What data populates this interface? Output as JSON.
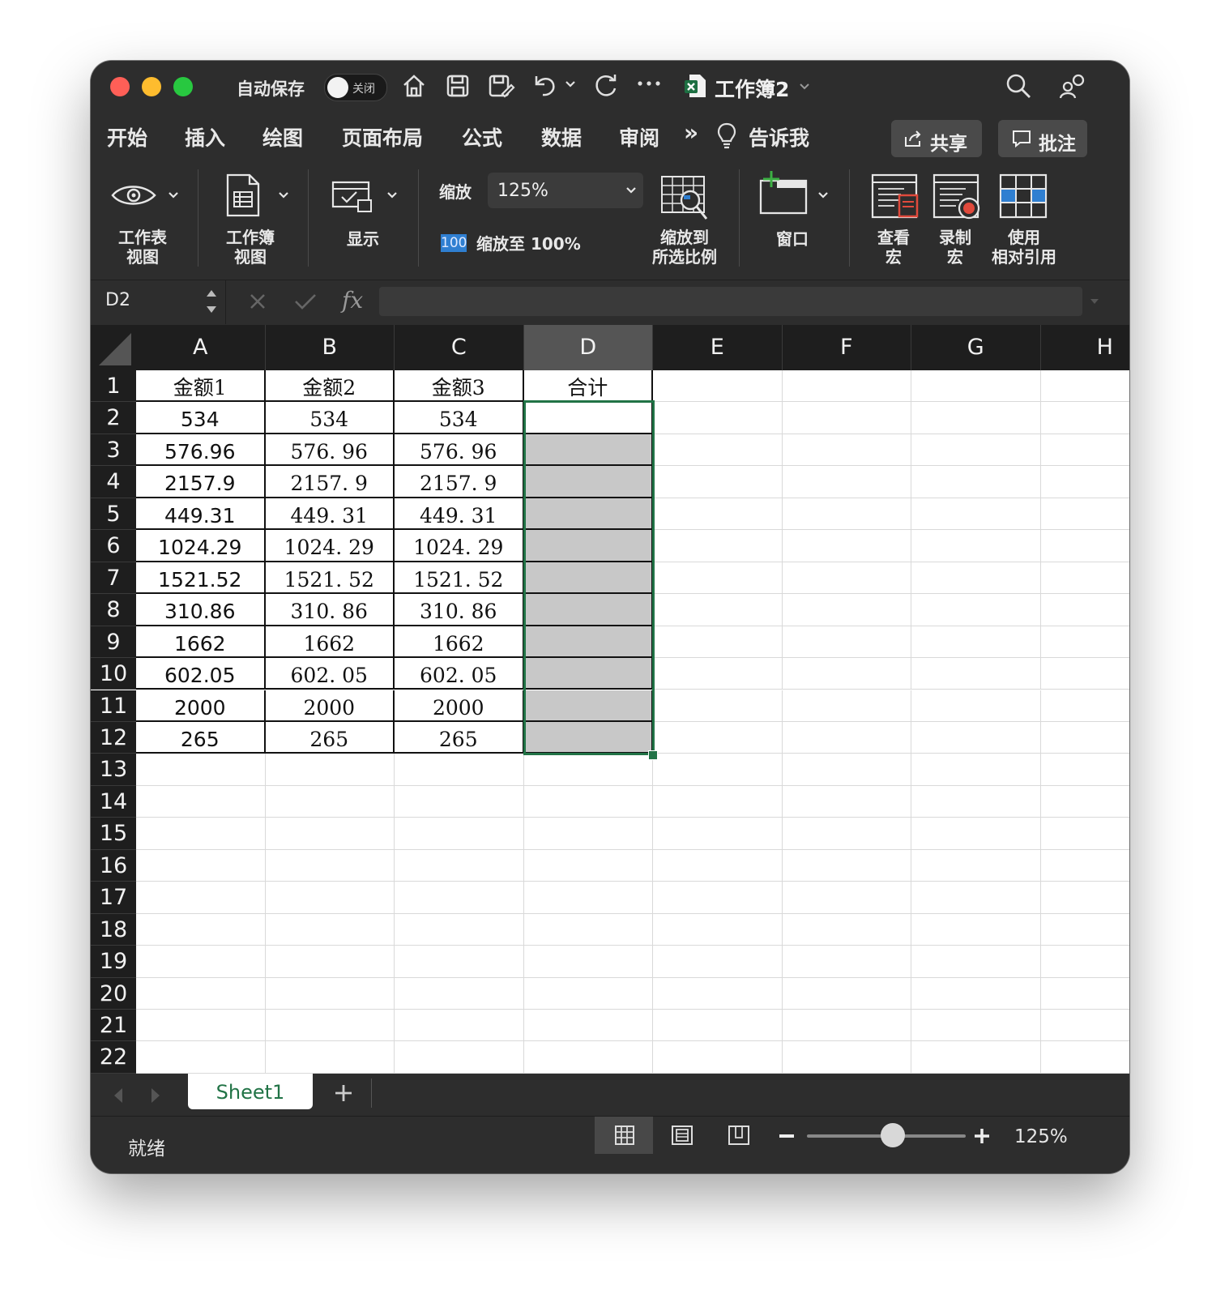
{
  "titlebar": {
    "autosave_label": "自动保存",
    "autosave_state": "关闭",
    "doc_title": "工作簿2"
  },
  "ribbon_tabs": [
    "开始",
    "插入",
    "绘图",
    "页面布局",
    "公式",
    "数据",
    "审阅"
  ],
  "more_tabs": "»",
  "tell_me": "告诉我",
  "share_label": "共享",
  "comments_label": "批注",
  "ribbon": {
    "sheet_view_1": "工作表",
    "sheet_view_2": "视图",
    "workbook_view_1": "工作簿",
    "workbook_view_2": "视图",
    "show": "显示",
    "zoom_label": "缩放",
    "zoom_value": "125%",
    "zoom100_badge": "100",
    "zoom100_label": "缩放至 100%",
    "zoom_sel_1": "缩放到",
    "zoom_sel_2": "所选比例",
    "window": "窗口",
    "view_macros_1": "查看",
    "view_macros_2": "宏",
    "record_macro_1": "录制",
    "record_macro_2": "宏",
    "relative_1": "使用",
    "relative_2": "相对引用"
  },
  "formula_bar": {
    "name_box": "D2",
    "fx": "fx",
    "value": ""
  },
  "columns": [
    "A",
    "B",
    "C",
    "D",
    "E",
    "F",
    "G",
    "H"
  ],
  "rows": [
    "1",
    "2",
    "3",
    "4",
    "5",
    "6",
    "7",
    "8",
    "9",
    "10",
    "11",
    "12",
    "13",
    "14",
    "15",
    "16",
    "17",
    "18",
    "19",
    "20",
    "21",
    "22"
  ],
  "headers": [
    "金额1",
    "金额2",
    "金额3",
    "合计"
  ],
  "col_a": [
    "534",
    "576.96",
    "2157.9",
    "449.31",
    "1024.29",
    "1521.52",
    "310.86",
    "1662",
    "602.05",
    "2000",
    "265"
  ],
  "col_b": [
    "534",
    "576. 96",
    "2157. 9",
    "449. 31",
    "1024. 29",
    "1521. 52",
    "310. 86",
    "1662",
    "602. 05",
    "2000",
    "265"
  ],
  "col_c": [
    "534",
    "576. 96",
    "2157. 9",
    "449. 31",
    "1024. 29",
    "1521. 52",
    "310. 86",
    "1662",
    "602. 05",
    "2000",
    "265"
  ],
  "sheet_tab": "Sheet1",
  "status": {
    "ready": "就绪",
    "zoom": "125%",
    "zoom_level_percent": 125
  },
  "colors": {
    "accent": "#217346",
    "chrome": "#2d2d2d",
    "header": "#1e1e1e",
    "selected_header": "#555555",
    "shade": "#c8c8c8"
  }
}
